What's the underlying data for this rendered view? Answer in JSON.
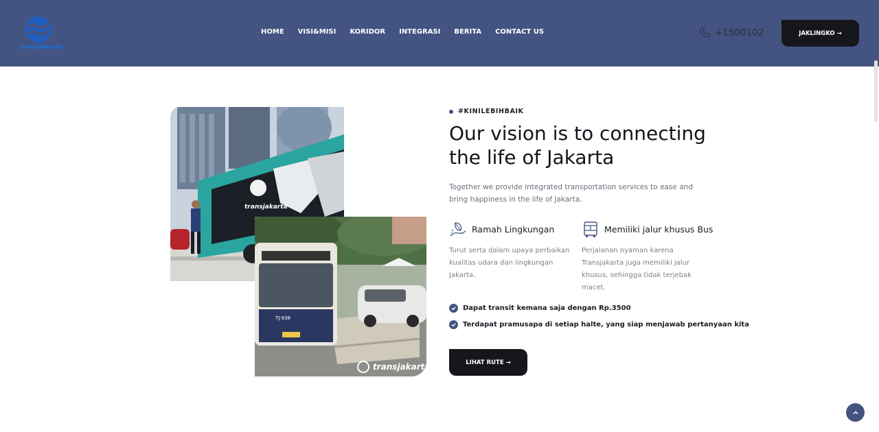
{
  "header": {
    "brand": "transjakarta",
    "nav": [
      "HOME",
      "VISI&MISI",
      "KORIDOR",
      "INTEGRASI",
      "BERITA",
      "CONTACT US"
    ],
    "phone": "+1500102",
    "cta_label": "JAKLINGKO →"
  },
  "main": {
    "tag": "#KINILEBIHBAIK",
    "title": "Our vision is to connecting the life of Jakarta",
    "lead": "Together we provide integrated transportation services to ease and bring happiness in the life of Jakarta.",
    "features": [
      {
        "icon": "leaf-hand-icon",
        "title": "Ramah Lingkungan",
        "desc": "Turut serta dalam upaya perbaikan kualitas udara dan lingkungan Jakarta."
      },
      {
        "icon": "bus-icon",
        "title": "Memiliki jalur khusus Bus",
        "desc": "Perjalanan nyaman karena Transjakarta juga memiliki jalur khusus, sehingga tidak terjebak macet."
      }
    ],
    "checks": [
      "Dapat transit kemana saja dengan Rp.3500",
      "Terdapat pramusapa di setiap halte, yang siap menjawab pertanyaan kita"
    ],
    "button_label": "LIHAT RUTE →"
  },
  "images": {
    "bus1_brand": "transjakarta",
    "bus2_brand": "transjakarta",
    "bus2_code": "TJ-938"
  },
  "colors": {
    "header_bg": "#435382",
    "button_bg": "#16171c",
    "accent": "#435382",
    "bus_teal": "#2aa5a0"
  }
}
